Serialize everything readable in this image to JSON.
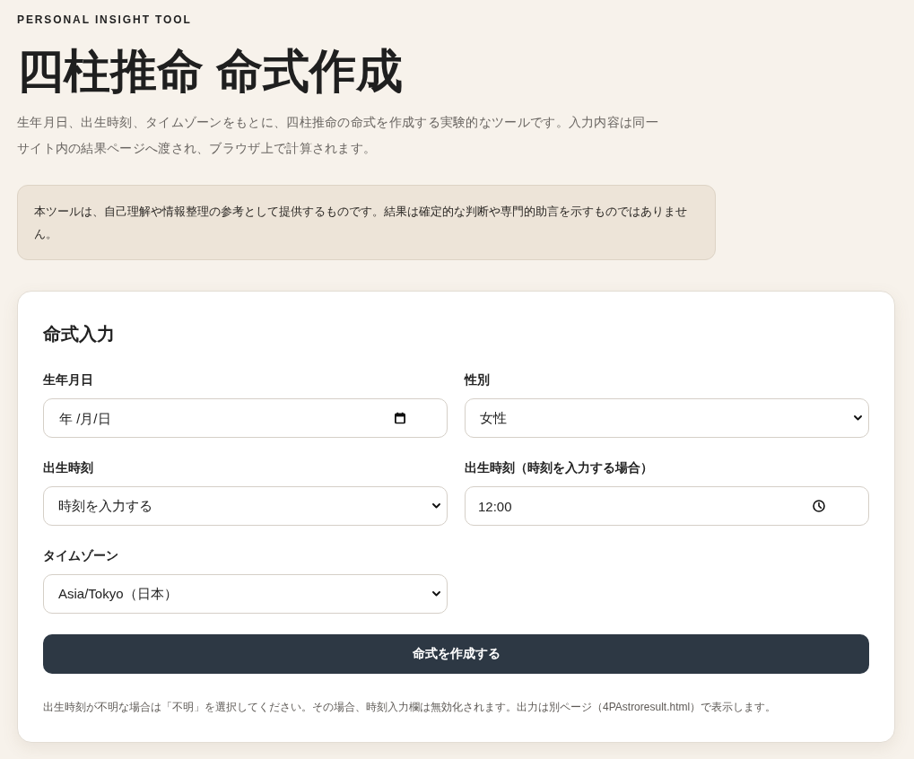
{
  "header": {
    "eyebrow": "PERSONAL INSIGHT TOOL",
    "title": "四柱推命 命式作成",
    "description": "生年月日、出生時刻、タイムゾーンをもとに、四柱推命の命式を作成する実験的なツールです。入力内容は同一サイト内の結果ページへ渡され、ブラウザ上で計算されます。"
  },
  "notice": "本ツールは、自己理解や情報整理の参考として提供するものです。結果は確定的な判断や専門的助言を示すものではありません。",
  "form": {
    "title": "命式入力",
    "fields": [
      {
        "kind": "date",
        "label": "生年月日",
        "placeholder": "年 /月/日"
      },
      {
        "kind": "select",
        "label": "性別",
        "value": "女性"
      },
      {
        "kind": "select",
        "label": "出生時刻",
        "value": "時刻を入力する"
      },
      {
        "kind": "time",
        "label": "出生時刻（時刻を入力する場合）",
        "value": "12:00"
      },
      {
        "kind": "select",
        "label": "タイムゾーン",
        "value": "Asia/Tokyo（日本）"
      }
    ],
    "submit": "命式を作成する",
    "note": "出生時刻が不明な場合は「不明」を選択してください。その場合、時刻入力欄は無効化されます。出力は別ページ（4PAstroresult.html）で表示します。"
  }
}
